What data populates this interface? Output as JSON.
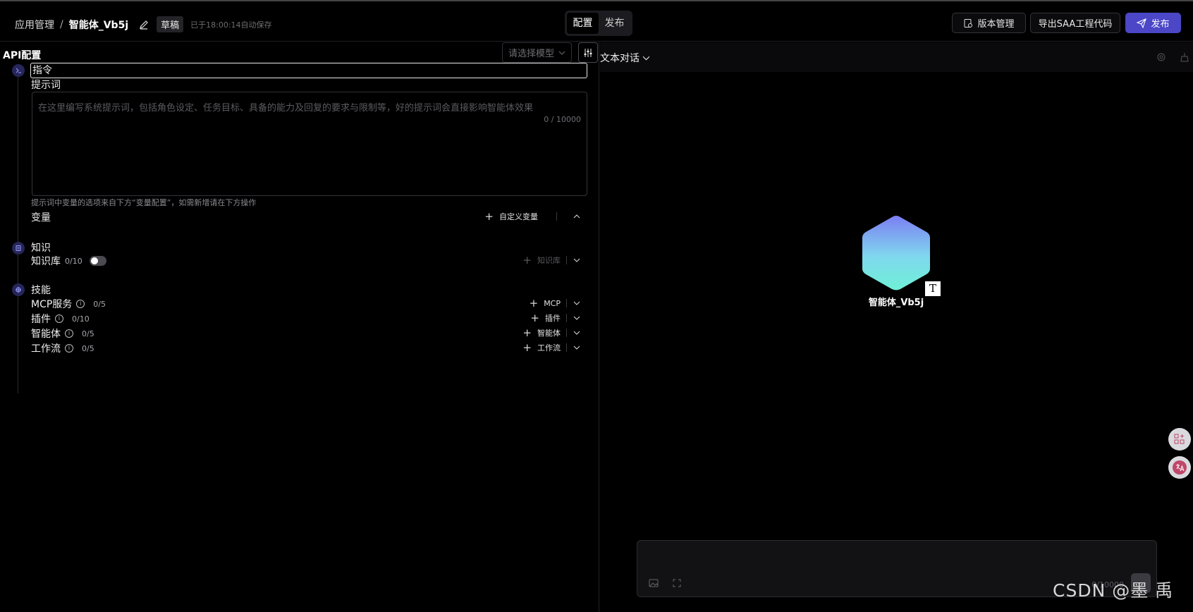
{
  "header": {
    "breadcrumb_root": "应用管理",
    "breadcrumb_sep": "/",
    "app_name": "智能体_Vb5j",
    "draft_badge": "草稿",
    "autosave": "已于18:00:14自动保存",
    "tabs": [
      {
        "label": "配置",
        "active": true
      },
      {
        "label": "发布",
        "active": false
      }
    ],
    "version_btn": "版本管理",
    "export_btn": "导出SAA工程代码",
    "publish_btn": "发布"
  },
  "config": {
    "title": "API配置",
    "model_placeholder": "请选择模型",
    "instruction": {
      "title": "指令",
      "prompt_label": "提示词",
      "prompt_placeholder": "在这里编写系统提示词，包括角色设定、任务目标、具备的能力及回复的要求与限制等，好的提示词会直接影响智能体效果",
      "prompt_count": "0 / 10000",
      "hint": "提示词中变量的选项来自下方“变量配置”，如需新增请在下方操作",
      "variables_label": "变量",
      "custom_var_btn": "自定义变量"
    },
    "knowledge": {
      "title": "知识",
      "kb_label": "知识库",
      "kb_count": "0/10",
      "kb_btn": "知识库"
    },
    "skills": {
      "title": "技能",
      "rows": [
        {
          "label": "MCP服务",
          "count": "0/5",
          "btn": "MCP"
        },
        {
          "label": "插件",
          "count": "0/10",
          "btn": "插件"
        },
        {
          "label": "智能体",
          "count": "0/5",
          "btn": "智能体"
        },
        {
          "label": "工作流",
          "count": "0/5",
          "btn": "工作流"
        }
      ]
    }
  },
  "preview": {
    "mode": "文本对话",
    "agent_name": "智能体_Vb5j",
    "avatar_letter": "T",
    "chat_count": "0/10000"
  },
  "watermark": "CSDN @墨 禹",
  "colors": {
    "accent": "#4b47c6",
    "bg": "#000000",
    "border": "#34343a"
  }
}
